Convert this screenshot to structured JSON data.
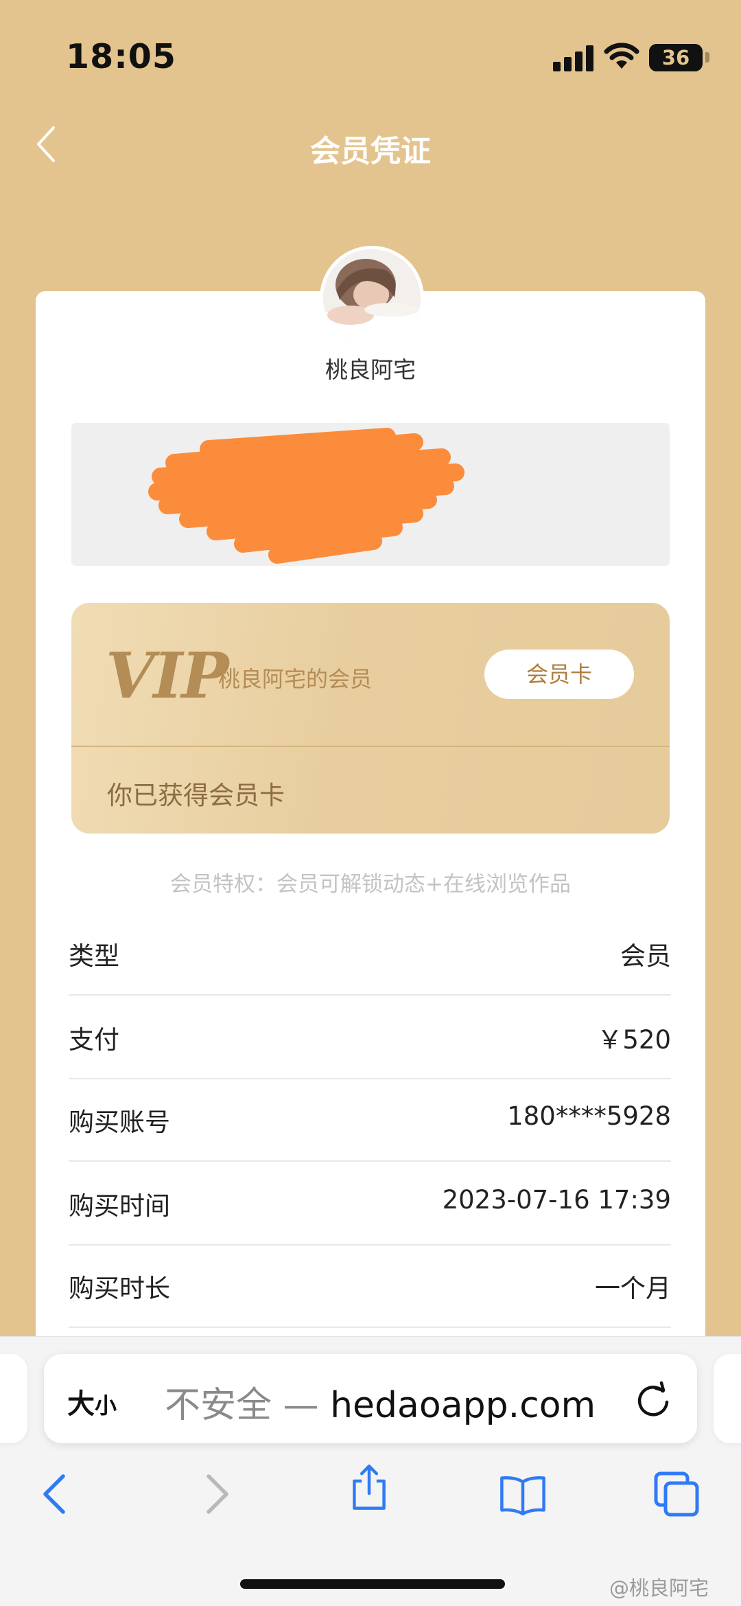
{
  "status_bar": {
    "time": "18:05",
    "battery": "36"
  },
  "nav": {
    "title": "会员凭证",
    "back_icon": "chevron-left-icon"
  },
  "profile": {
    "username": "桃良阿宅"
  },
  "vip_card": {
    "logo": "VIP",
    "subtitle": "桃良阿宅的会员",
    "card_button": "会员卡",
    "status": "你已获得会员卡"
  },
  "privilege_note": "会员特权：会员可解锁动态+在线浏览作品",
  "details": [
    {
      "label": "类型",
      "value": "会员"
    },
    {
      "label": "支付",
      "value": "￥520"
    },
    {
      "label": "购买账号",
      "value": "180****5928"
    },
    {
      "label": "购买时间",
      "value": "2023-07-16 17:39"
    },
    {
      "label": "购买时长",
      "value": "一个月"
    }
  ],
  "browser": {
    "text_size_big": "大",
    "text_size_small": "小",
    "security": "不安全 — ",
    "domain": "hedaoapp.com"
  },
  "watermark": "@桃良阿宅",
  "colors": {
    "background": "#E3C48E",
    "vip_gold": "#B48C55",
    "redaction": "#FB8C3C",
    "link_blue": "#2F7BF5"
  }
}
